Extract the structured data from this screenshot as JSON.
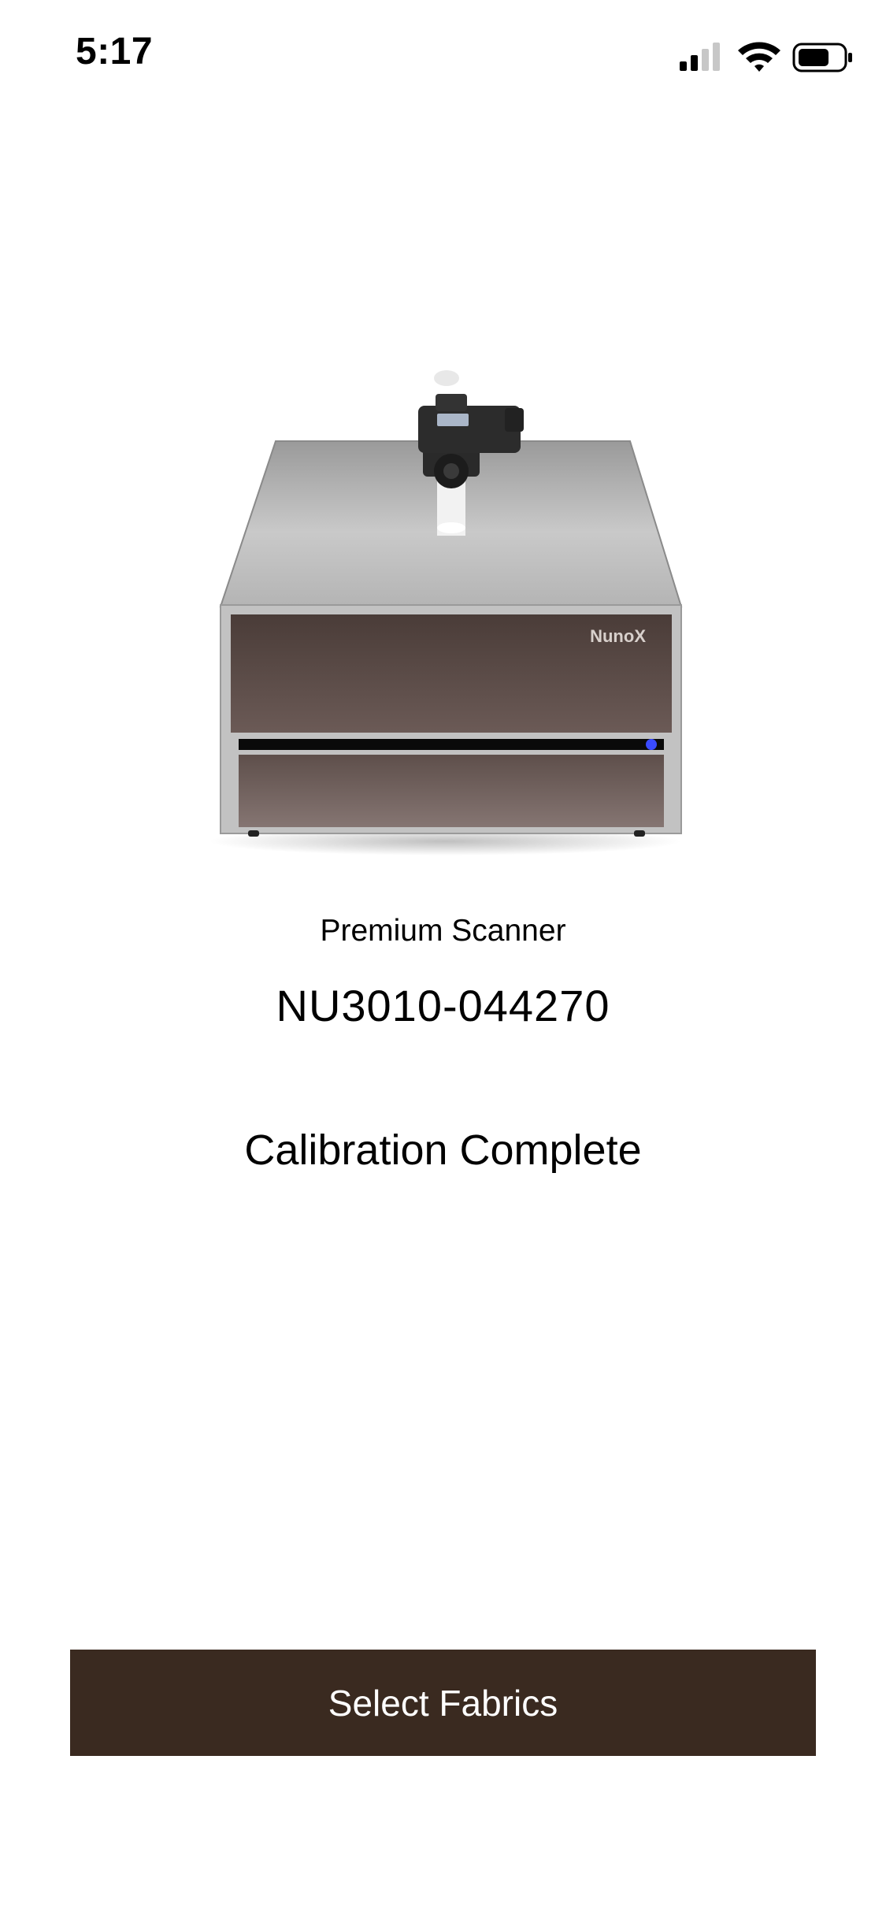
{
  "status_bar": {
    "time": "5:17",
    "icons": [
      "cellular-signal-icon",
      "wifi-icon",
      "battery-icon"
    ]
  },
  "device": {
    "image_icon": "scanner-device-illustration",
    "brand_label": "NunoX",
    "model": "Premium Scanner",
    "serial": "NU3010-044270"
  },
  "status": {
    "message": "Calibration Complete"
  },
  "actions": {
    "select_fabrics_label": "Select Fabrics"
  },
  "colors": {
    "button_bg": "#3a2a20",
    "button_text": "#ffffff",
    "background": "#ffffff"
  }
}
